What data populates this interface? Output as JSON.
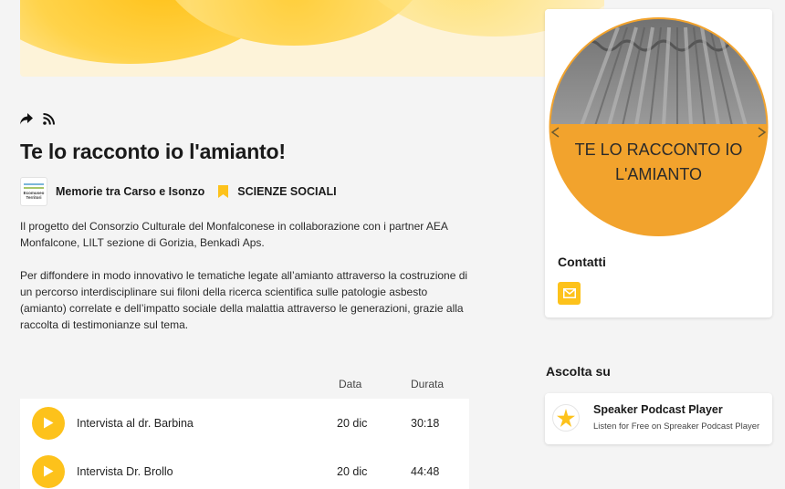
{
  "podcast": {
    "title": "Te lo racconto io l'amianto!",
    "author": "Memorie tra Carso e Isonzo",
    "category": "SCIENZE SOCIALI",
    "logo_text": "Ecomuseo Territori",
    "description": [
      "Il progetto del Consorzio Culturale del Monfalconese in collaborazione con i partner AEA Monfalcone, LILT sezione di Gorizia, Benkadì Aps.",
      "Per diffondere in modo innovativo le tematiche legate all’amianto attraverso la costruzione di un percorso interdisciplinare sui filoni della ricerca scientifica sulle patologie asbesto (amianto) correlate e dell’impatto sociale della malattia attraverso le generazioni, grazie alla raccolta di testimonianze sul tema."
    ]
  },
  "actions": {
    "share_icon": "share-icon",
    "rss_icon": "rss-icon"
  },
  "episodes": {
    "headers": {
      "date": "Data",
      "duration": "Durata"
    },
    "items": [
      {
        "title": "Intervista al dr. Barbina",
        "date": "20 dic",
        "duration": "30:18"
      },
      {
        "title": "Intervista Dr. Brollo",
        "date": "20 dic",
        "duration": "44:48"
      }
    ]
  },
  "sidebar": {
    "cover_text_line1": "TE LO RACCONTO IO",
    "cover_text_line2": "L'AMIANTO",
    "contacts_title": "Contatti",
    "listen_title": "Ascolta su",
    "player": {
      "name": "Speaker Podcast Player",
      "description": "Listen for Free on Spreaker Podcast Player"
    }
  },
  "colors": {
    "accent": "#fdc21b",
    "cover_orange": "#f2a32d",
    "background": "#f4f4f4"
  }
}
